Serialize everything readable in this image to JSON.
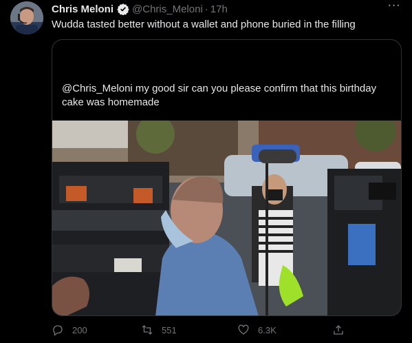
{
  "tweet": {
    "author_name": "Chris Meloni",
    "handle": "@Chris_Meloni",
    "separator": "·",
    "time": "17h",
    "more": "···",
    "text": "Wudda tasted better without a wallet and phone buried in the filling"
  },
  "quoted": {
    "text": "@Chris_Meloni my good sir can you please confirm that this birthday cake was homemade"
  },
  "actions": {
    "replies": "200",
    "retweets": "551",
    "likes": "6.3K"
  },
  "icons": {
    "verified": "verified-badge-icon",
    "reply": "reply-icon",
    "retweet": "retweet-icon",
    "like": "heart-icon",
    "share": "share-icon"
  },
  "colors": {
    "background": "#000000",
    "text": "#e7e9ea",
    "secondary": "#71767b",
    "border": "#2f3336"
  }
}
